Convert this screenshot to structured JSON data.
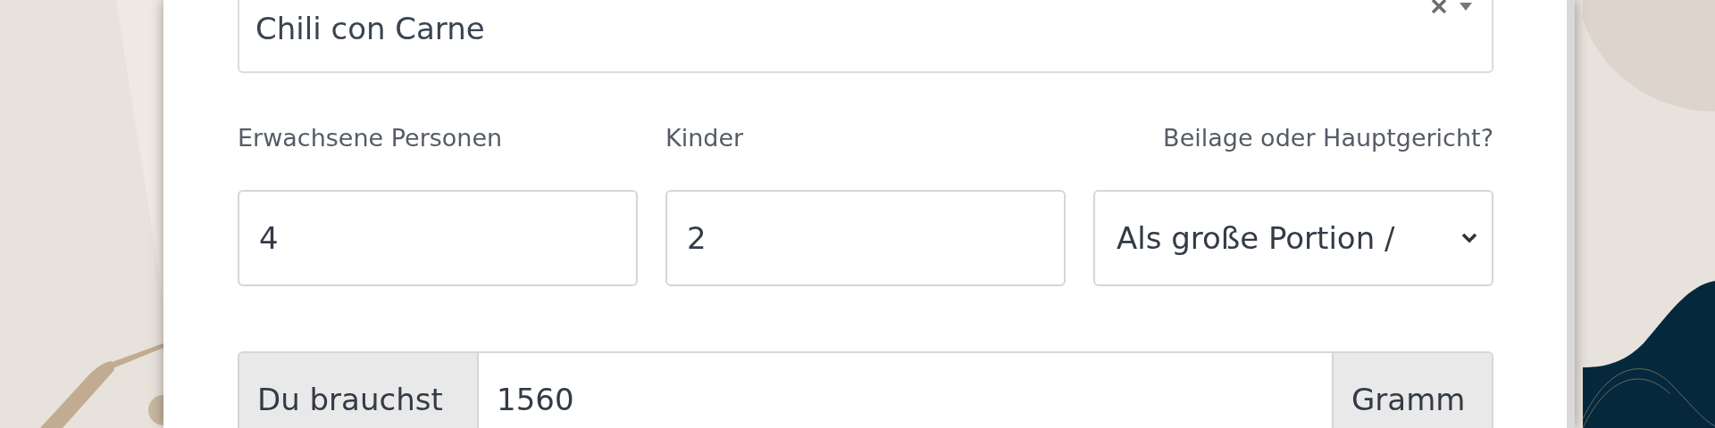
{
  "recipe_select": {
    "value": "Chili con Carne",
    "clearable": true
  },
  "fields": [
    {
      "label": "Erwachsene Personen",
      "kind": "input",
      "value": "4"
    },
    {
      "label": "Kinder",
      "kind": "input",
      "value": "2"
    },
    {
      "label": "Beilage oder Hauptgericht?",
      "kind": "select",
      "value": "Als große Portion /"
    }
  ],
  "result": {
    "prefix": "Du brauchst",
    "value": "1560",
    "suffix": "Gramm"
  }
}
